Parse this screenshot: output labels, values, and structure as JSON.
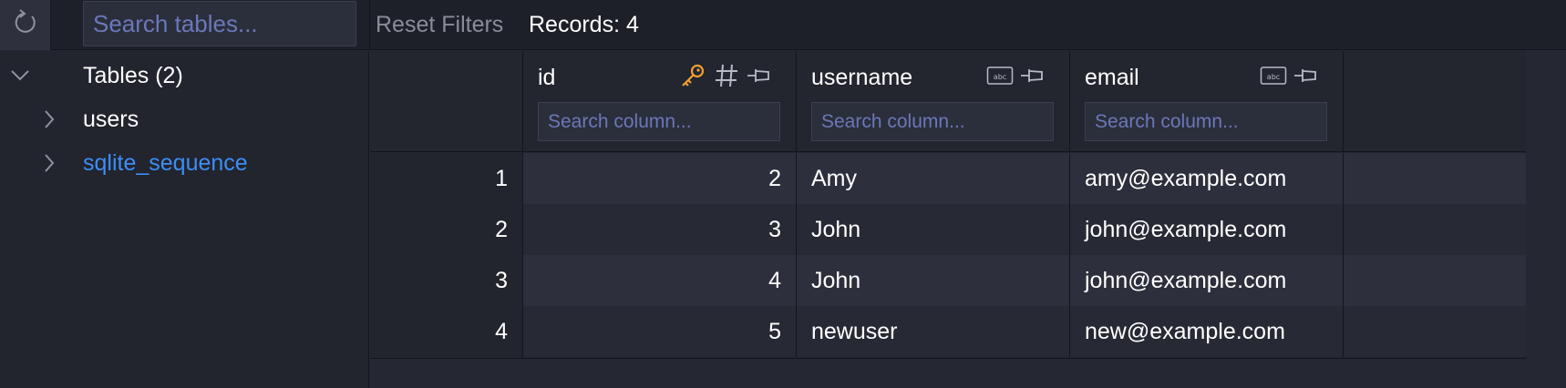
{
  "toolbar": {
    "search_placeholder": "Search tables...",
    "reset_filters_label": "Reset Filters",
    "records_label": "Records: 4",
    "refresh_icon": "refresh-icon"
  },
  "sidebar": {
    "group": {
      "label": "Tables (2)",
      "expanded": true
    },
    "tables": [
      {
        "label": "users",
        "selected": false
      },
      {
        "label": "sqlite_sequence",
        "selected": true
      }
    ]
  },
  "grid": {
    "columns": [
      {
        "name": "id",
        "icons": [
          "key-icon",
          "hash-icon",
          "pin-icon"
        ],
        "search_placeholder": "Search column..."
      },
      {
        "name": "username",
        "icons": [
          "text-type-icon",
          "pin-icon"
        ],
        "search_placeholder": "Search column..."
      },
      {
        "name": "email",
        "icons": [
          "text-type-icon",
          "pin-icon"
        ],
        "search_placeholder": "Search column..."
      }
    ],
    "rows": [
      {
        "n": "1",
        "id": "2",
        "username": "Amy",
        "email": "amy@example.com"
      },
      {
        "n": "2",
        "id": "3",
        "username": "John",
        "email": "john@example.com"
      },
      {
        "n": "3",
        "id": "4",
        "username": "John",
        "email": "john@example.com"
      },
      {
        "n": "4",
        "id": "5",
        "username": "newuser",
        "email": "new@example.com"
      }
    ]
  },
  "colors": {
    "background": "#252833",
    "link": "#3d8ef5",
    "key_icon": "#f0a030",
    "placeholder": "#6b78b8"
  }
}
